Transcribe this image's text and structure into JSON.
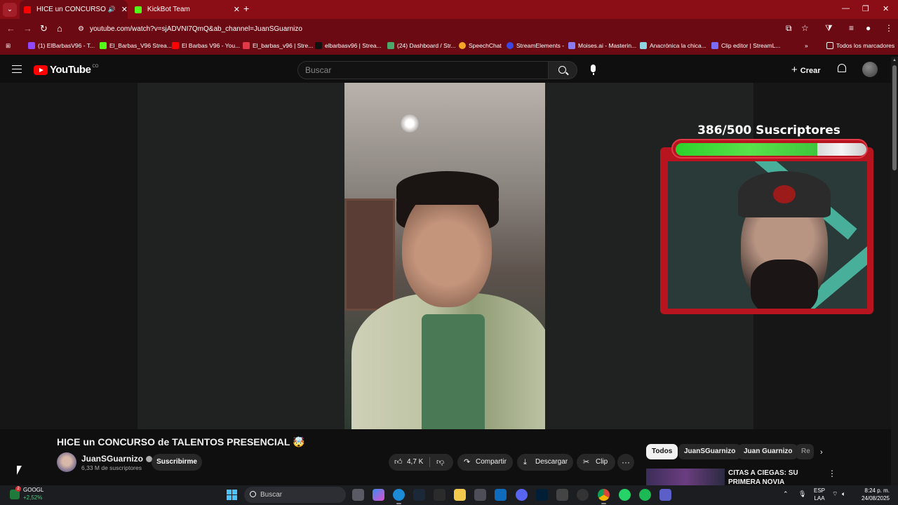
{
  "browser": {
    "tabs": [
      {
        "title": "HICE un CONCURSO de TALENTOS PRESENCIAL",
        "active": true,
        "playing_audio": true
      },
      {
        "title": "KickBot Team",
        "active": false
      }
    ],
    "url": "youtube.com/watch?v=sjADVNI7QmQ&ab_channel=JuanSGuarnizo",
    "bookmarks": [
      "(1) ElBarbasV96 - T...",
      "El_Barbas_V96 Strea...",
      "El Barbas V96 - You...",
      "El_barbas_v96 | Stre...",
      "elbarbasv96 | Strea...",
      "(24) Dashboard / Str...",
      "SpeechChat",
      "StreamElements -",
      "Moises.ai - Masterin...",
      "Anacrónica la chica...",
      "Clip editor | StreamL..."
    ],
    "bookmarks_overflow": "»",
    "all_bookmarks": "Todos los marcadores",
    "colors": {
      "chrome": "#8b0e17",
      "chrome_dark": "#6b0a12",
      "yt_red": "#ff0000"
    }
  },
  "youtube": {
    "logo_text": "YouTube",
    "country_code": "CO",
    "search_placeholder": "Buscar",
    "create_label": "Crear"
  },
  "video": {
    "title": "HICE un CONCURSO de TALENTOS PRESENCIAL 🤯",
    "overlay": {
      "subscriber_goal_text": "386/500 Suscriptores",
      "subscribers_current": 386,
      "subscribers_goal": 500,
      "progress_fraction": 0.772
    },
    "channel": {
      "name": "JuanSGuarnizo",
      "subscribers": "6,33 M de suscriptores",
      "verified": true
    },
    "subscribe_label": "Suscribirme",
    "likes": "4,7 K",
    "share_label": "Compartir",
    "download_label": "Descargar",
    "clip_label": "Clip",
    "more_label": "···"
  },
  "sidebar": {
    "chips": [
      "Todos",
      "JuanSGuarnizo",
      "Juan Guarnizo",
      "Re"
    ],
    "chip_arrow": "›",
    "recommendation": {
      "title": "CITAS A CIEGAS: SU PRIMERA NOVIA"
    }
  },
  "taskbar": {
    "stock": {
      "name": "GOOGL",
      "change": "+2,52%",
      "badge": "2"
    },
    "search_placeholder": "Buscar",
    "language": {
      "line1": "ESP",
      "line2": "LAA"
    },
    "time": "8:24 p. m.",
    "date": "24/08/2025"
  }
}
